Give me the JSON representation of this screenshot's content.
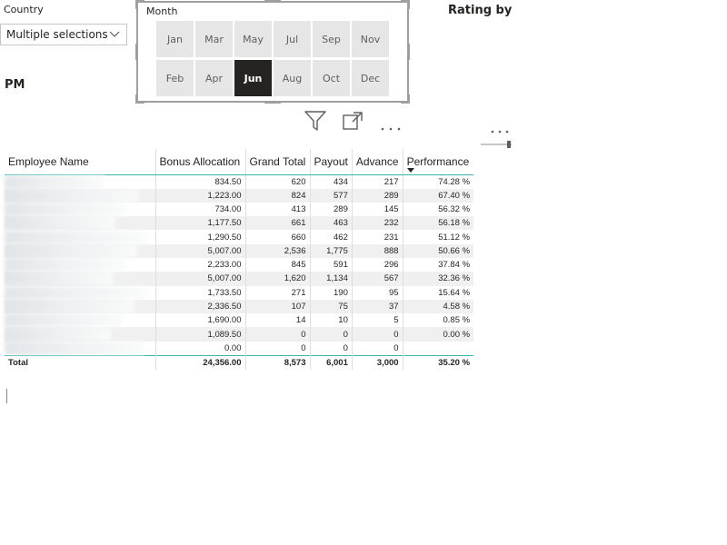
{
  "country_slicer": {
    "label": "Country",
    "selected": "Multiple selections"
  },
  "month_slicer": {
    "label": "Month",
    "months": [
      {
        "label": "Jan",
        "selected": false
      },
      {
        "label": "Mar",
        "selected": false
      },
      {
        "label": "May",
        "selected": false
      },
      {
        "label": "Jul",
        "selected": false
      },
      {
        "label": "Sep",
        "selected": false
      },
      {
        "label": "Nov",
        "selected": false
      },
      {
        "label": "Feb",
        "selected": false
      },
      {
        "label": "Apr",
        "selected": false
      },
      {
        "label": "Jun",
        "selected": true
      },
      {
        "label": "Aug",
        "selected": false
      },
      {
        "label": "Oct",
        "selected": false
      },
      {
        "label": "Dec",
        "selected": false
      }
    ]
  },
  "rating_title": "Rating by",
  "pm_label": "PM",
  "visual_header": {
    "icons": [
      "filter-icon",
      "focus-mode-icon",
      "more-options-icon"
    ]
  },
  "table": {
    "columns": [
      "Employee Name",
      "Bonus Allocation",
      "Grand Total",
      "Payout",
      "Advance",
      "Performance"
    ],
    "sorted_column": "Performance",
    "rows": [
      {
        "bonus": "834.50",
        "grand_total": "620",
        "payout": "434",
        "advance": "217",
        "performance": "74.28 %"
      },
      {
        "bonus": "1,223.00",
        "grand_total": "824",
        "payout": "577",
        "advance": "289",
        "performance": "67.40 %"
      },
      {
        "bonus": "734.00",
        "grand_total": "413",
        "payout": "289",
        "advance": "145",
        "performance": "56.32 %"
      },
      {
        "bonus": "1,177.50",
        "grand_total": "661",
        "payout": "463",
        "advance": "232",
        "performance": "56.18 %"
      },
      {
        "bonus": "1,290.50",
        "grand_total": "660",
        "payout": "462",
        "advance": "231",
        "performance": "51.12 %"
      },
      {
        "bonus": "5,007.00",
        "grand_total": "2,536",
        "payout": "1,775",
        "advance": "888",
        "performance": "50.66 %"
      },
      {
        "bonus": "2,233.00",
        "grand_total": "845",
        "payout": "591",
        "advance": "296",
        "performance": "37.84 %"
      },
      {
        "bonus": "5,007.00",
        "grand_total": "1,620",
        "payout": "1,134",
        "advance": "567",
        "performance": "32.36 %"
      },
      {
        "bonus": "1,733.50",
        "grand_total": "271",
        "payout": "190",
        "advance": "95",
        "performance": "15.64 %"
      },
      {
        "bonus": "2,336.50",
        "grand_total": "107",
        "payout": "75",
        "advance": "37",
        "performance": "4.58 %"
      },
      {
        "bonus": "1,690.00",
        "grand_total": "14",
        "payout": "10",
        "advance": "5",
        "performance": "0.85 %"
      },
      {
        "bonus": "1,089.50",
        "grand_total": "0",
        "payout": "0",
        "advance": "0",
        "performance": "0.00 %"
      },
      {
        "bonus": "0.00",
        "grand_total": "0",
        "payout": "0",
        "advance": "0",
        "performance": ""
      }
    ],
    "total": {
      "label": "Total",
      "bonus": "24,356.00",
      "grand_total": "8,573",
      "payout": "6,001",
      "advance": "3,000",
      "performance": "35.20 %"
    }
  },
  "colors": {
    "accent_teal": "#39b5ac",
    "selected_tile": "#252423",
    "tile": "#e6e6e6"
  }
}
